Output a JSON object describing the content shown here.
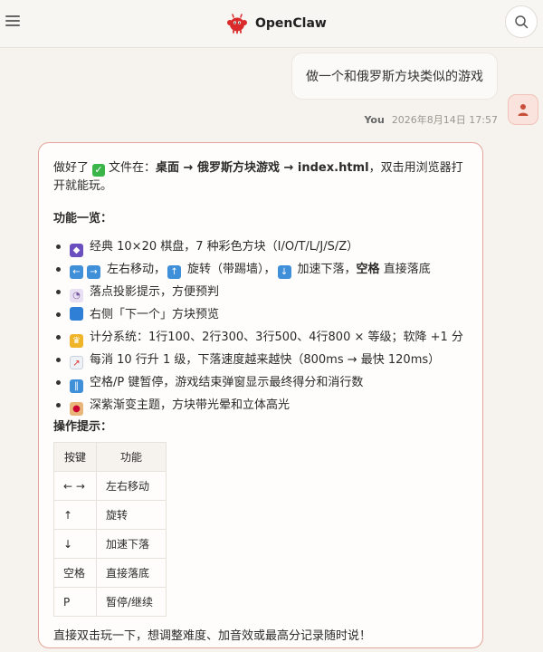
{
  "app": {
    "name": "OpenClaw"
  },
  "user_message": {
    "text": "做一个和俄罗斯方块类似的游戏",
    "author": "You",
    "timestamp": "2026年8月14日 17:57"
  },
  "assistant": {
    "intro_prefix": "做好了",
    "intro_file_label": "文件在：",
    "intro_path": "桌面 → 俄罗斯方块游戏 → index.html",
    "intro_suffix": "，双击用浏览器打开就能玩。",
    "features_title": "功能一览：",
    "features": [
      {
        "icon": "gamepad-icon",
        "text": "经典 10×20 棋盘，7 种彩色方块（I/O/T/L/J/S/Z）"
      },
      {
        "icon": "arrow-keys-icon",
        "text_a": "左右移动，",
        "text_b": "旋转（带踢墙），",
        "text_c": "加速下落，",
        "bold": "空格",
        "text_d": " 直接落底"
      },
      {
        "icon": "ghost-icon",
        "text": "落点投影提示，方便预判"
      },
      {
        "icon": "blue-square-icon",
        "text": "右侧「下一个」方块预览"
      },
      {
        "icon": "trophy-icon",
        "text": "计分系统：1行100、2行300、3行500、4行800 × 等级；软降 +1 分"
      },
      {
        "icon": "chart-icon",
        "text": "每消 10 行升 1 级，下落速度越来越快（800ms → 最快 120ms）"
      },
      {
        "icon": "pause-icon",
        "text": "空格/P 键暂停，游戏结束弹窗显示最终得分和消行数"
      },
      {
        "icon": "palette-icon",
        "text": "深紫渐变主题，方块带光晕和立体高光"
      }
    ],
    "tips_title": "操作提示：",
    "table": {
      "headers": [
        "按键",
        "功能"
      ],
      "rows": [
        [
          "← →",
          "左右移动"
        ],
        [
          "↑",
          "旋转"
        ],
        [
          "↓",
          "加速下落"
        ],
        [
          "空格",
          "直接落底"
        ],
        [
          "P",
          "暂停/继续"
        ]
      ]
    },
    "outro": "直接双击玩一下，想调整难度、加音效或最高分记录随时说！"
  },
  "colors": {
    "accent": "#e3a59b",
    "logo": "#d92b2b",
    "background": "#f6f3ee"
  }
}
